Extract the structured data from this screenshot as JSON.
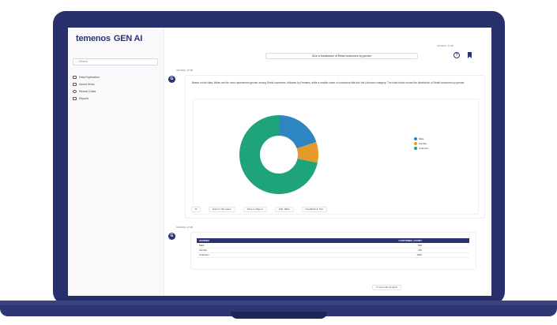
{
  "app": {
    "brand": "temenos",
    "product": "GEN AI"
  },
  "sidebar": {
    "search_placeholder": "Search",
    "items": [
      {
        "label": "Data Exploration",
        "icon": "chart-icon"
      },
      {
        "label": "Saved Items",
        "icon": "bookmark-icon"
      },
      {
        "label": "Recent Chats",
        "icon": "clock-icon"
      },
      {
        "label": "Reports",
        "icon": "report-icon"
      }
    ]
  },
  "header": {
    "meta": "31/10/24, 17:48",
    "query": "Give a breakdown of Retail customers by gender"
  },
  "answer": {
    "meta": "31/10/24, 17:48",
    "avatar": "G",
    "text": "Based on the data, Males are the most represented gender among Retail customers, followed by Females, while a smaller share of customers falls into the Unknown category. The chart below shows the distribution of Retail customers by gender."
  },
  "chart_data": {
    "type": "pie",
    "donut": true,
    "labels": [
      "Male",
      "Female",
      "Unknown"
    ],
    "values": [
      530,
      230,
      1920
    ],
    "colors": [
      "#2e86c1",
      "#e59a2b",
      "#1ea37a"
    ],
    "legend_position": "right"
  },
  "actions": {
    "copy": "",
    "export": "Export / Re-query",
    "save": "Save to Report",
    "table": "SQL Table",
    "feedback": "Feedback & Tips"
  },
  "table_answer": {
    "meta": "31/10/24, 17:48",
    "avatar": "G",
    "columns": [
      "GENDER",
      "CUSTOMER_COUNT"
    ],
    "rows": [
      [
        "Male",
        "530"
      ],
      [
        "Female",
        "230"
      ],
      [
        "Unknown",
        "1920"
      ]
    ]
  },
  "footer": {
    "button": "Generate Insights"
  },
  "colors": {
    "navy": "#27306b",
    "accent": "#2b3374"
  }
}
